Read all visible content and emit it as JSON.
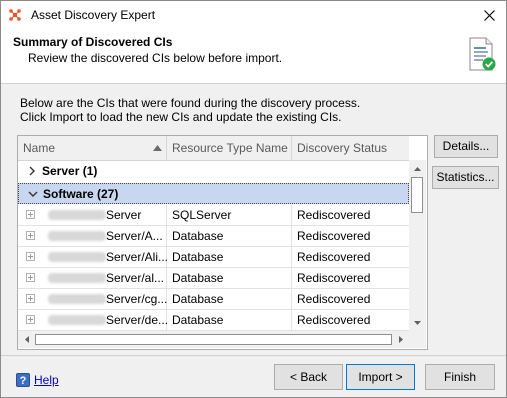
{
  "window": {
    "title": "Asset Discovery Expert"
  },
  "header": {
    "title": "Summary of Discovered CIs",
    "subtitle": "Review the discovered CIs below before import."
  },
  "intro": {
    "line1": "Below are the CIs that were found during the discovery process.",
    "line2": "Click Import to load the new CIs and update the existing CIs."
  },
  "grid": {
    "columns": [
      "Name",
      "Resource Type Name",
      "Discovery Status"
    ],
    "groups": [
      {
        "label": "Server (1)"
      },
      {
        "label": "Software (27)"
      }
    ],
    "rows": [
      {
        "name": "Server",
        "type": "SQLServer",
        "status": "Rediscovered"
      },
      {
        "name": "Server/A...",
        "type": "Database",
        "status": "Rediscovered"
      },
      {
        "name": "Server/Ali...",
        "type": "Database",
        "status": "Rediscovered"
      },
      {
        "name": "Server/al...",
        "type": "Database",
        "status": "Rediscovered"
      },
      {
        "name": "Server/cg...",
        "type": "Database",
        "status": "Rediscovered"
      },
      {
        "name": "Server/de...",
        "type": "Database",
        "status": "Rediscovered"
      }
    ]
  },
  "side_buttons": {
    "details": "Details...",
    "statistics": "Statistics..."
  },
  "footer": {
    "help": "Help",
    "back": "< Back",
    "import": "Import >",
    "finish": "Finish"
  },
  "icons": {
    "app": "asset-discovery-icon",
    "close": "close-icon",
    "document": "document-check-icon",
    "help": "help-icon"
  },
  "colors": {
    "selection": "#c8d7ef",
    "link": "#0000cc",
    "check_green": "#2aa84a"
  }
}
